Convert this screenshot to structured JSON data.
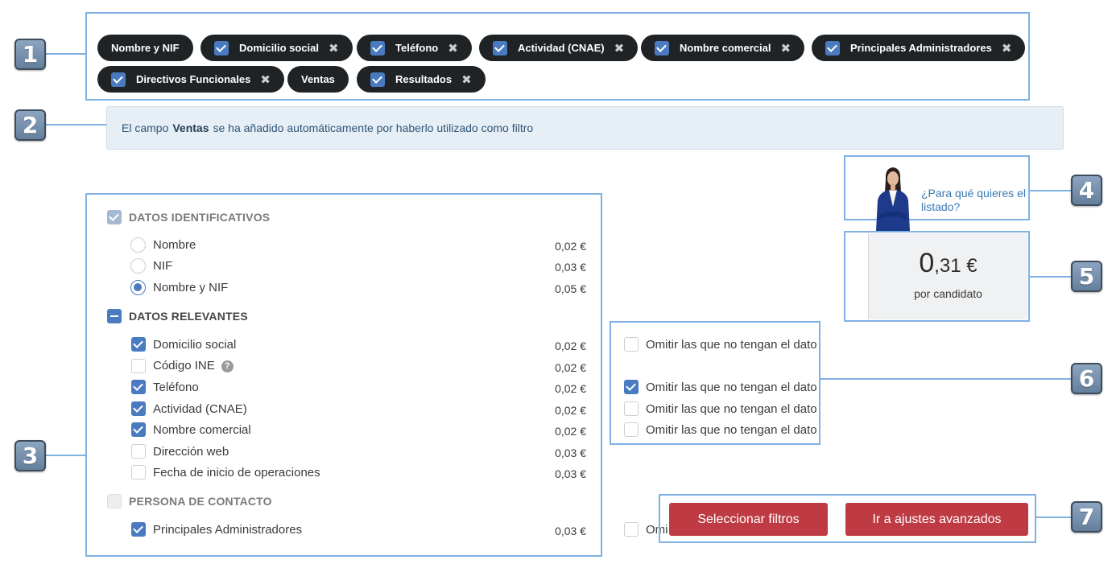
{
  "callouts": [
    "1",
    "2",
    "3",
    "4",
    "5",
    "6",
    "7"
  ],
  "tags": [
    {
      "label": "Nombre y NIF",
      "removable": false
    },
    {
      "label": "Domicilio social",
      "removable": true
    },
    {
      "label": "Teléfono",
      "removable": true
    },
    {
      "label": "Actividad (CNAE)",
      "removable": true
    },
    {
      "label": "Nombre comercial",
      "removable": true
    },
    {
      "label": "Principales Administradores",
      "removable": true
    },
    {
      "label": "Directivos Funcionales",
      "removable": true
    },
    {
      "label": "Ventas",
      "removable": false
    },
    {
      "label": "Resultados",
      "removable": true
    }
  ],
  "tag_remove_glyph": "✖",
  "info": {
    "prefix": "El campo",
    "field": "Ventas",
    "suffix": "se ha añadido automáticamente por haberlo utilizado como filtro"
  },
  "sections": {
    "identificativos": {
      "title": "DATOS IDENTIFICATIVOS",
      "options": [
        {
          "label": "Nombre",
          "price": "0,02 €",
          "selected": false
        },
        {
          "label": "NIF",
          "price": "0,03 €",
          "selected": false
        },
        {
          "label": "Nombre y NIF",
          "price": "0,05 €",
          "selected": true
        }
      ]
    },
    "relevantes": {
      "title": "DATOS RELEVANTES",
      "options": [
        {
          "label": "Domicilio social",
          "price": "0,02 €",
          "checked": true
        },
        {
          "label": "Código INE",
          "price": "0,02 €",
          "checked": false,
          "help": "?"
        },
        {
          "label": "Teléfono",
          "price": "0,02 €",
          "checked": true
        },
        {
          "label": "Actividad (CNAE)",
          "price": "0,02 €",
          "checked": true
        },
        {
          "label": "Nombre comercial",
          "price": "0,02 €",
          "checked": true
        },
        {
          "label": "Dirección web",
          "price": "0,03 €",
          "checked": false
        },
        {
          "label": "Fecha de inicio de operaciones",
          "price": "0,03 €",
          "checked": false
        }
      ]
    },
    "contacto": {
      "title": "PERSONA DE CONTACTO",
      "options": [
        {
          "label": "Principales Administradores",
          "price": "0,03 €",
          "checked": true
        }
      ]
    }
  },
  "omit": {
    "label": "Omitir las que no tengan el dato",
    "partial_label": "Omi",
    "states": [
      false,
      true,
      false,
      false,
      false
    ]
  },
  "help_link": {
    "line1": "¿Para qué quieres el",
    "line2": "listado?"
  },
  "price": {
    "integer": "0",
    "decimals": ",31 €",
    "caption": "por candidato"
  },
  "buttons": {
    "filters": "Seleccionar filtros",
    "advanced": "Ir a ajustes avanzados"
  },
  "colors": {
    "accent": "#4a7bc0",
    "callout": "#7fb1e3",
    "button": "#bf3b44",
    "tag_bg": "#1f2326"
  }
}
